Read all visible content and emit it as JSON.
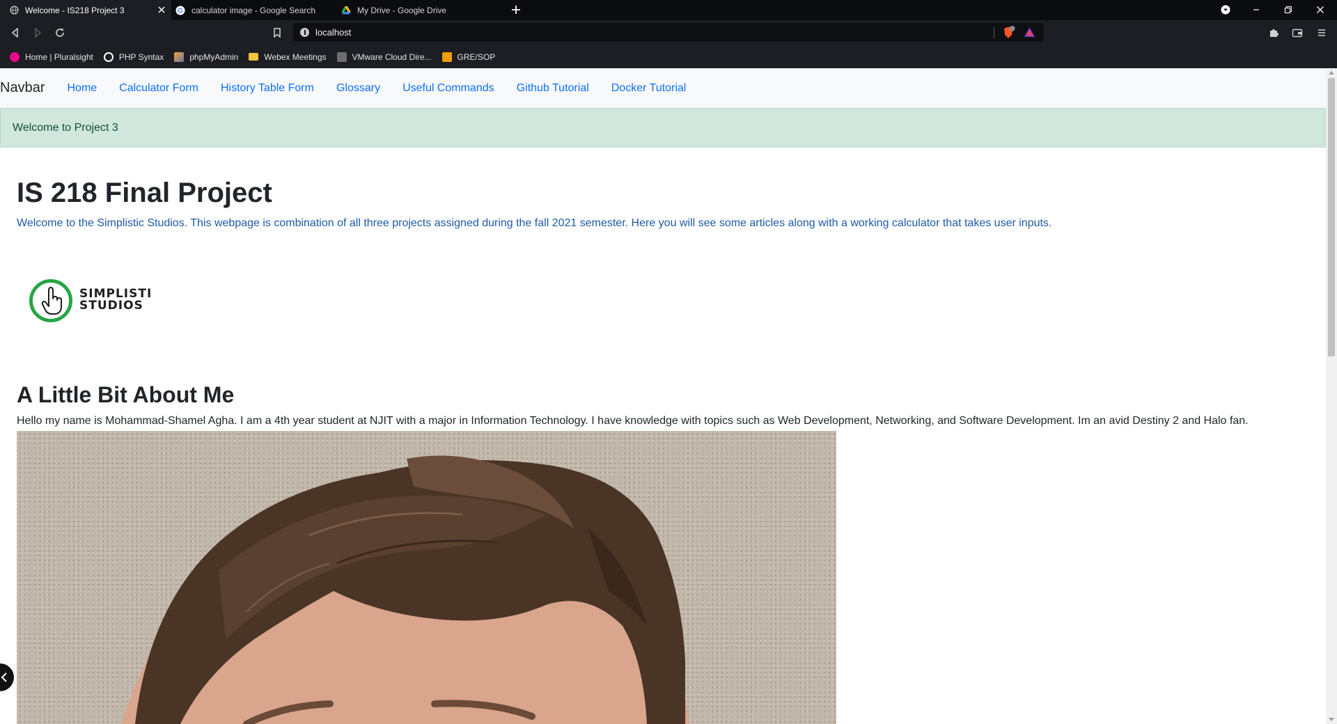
{
  "browser": {
    "tabs": [
      {
        "title": "Welcome - IS218 Project 3",
        "active": true
      },
      {
        "title": "calculator image - Google Search",
        "active": false
      },
      {
        "title": "My Drive - Google Drive",
        "active": false
      }
    ],
    "url": "localhost",
    "bookmarks": [
      {
        "label": "Home | Pluralsight",
        "icon": "pluralsight-icon",
        "color": "#e80a89"
      },
      {
        "label": "PHP Syntax",
        "icon": "circle-icon",
        "color": "#ffffff"
      },
      {
        "label": "phpMyAdmin",
        "icon": "phpmyadmin-icon",
        "color": "#f0a030"
      },
      {
        "label": "Webex Meetings",
        "icon": "folder-icon",
        "color": "#f4c542"
      },
      {
        "label": "VMware Cloud Dire...",
        "icon": "vmware-icon",
        "color": "#6d6d6d"
      },
      {
        "label": "GRE/SOP",
        "icon": "bookmark-icon",
        "color": "#f59b00"
      }
    ]
  },
  "page": {
    "navbar": {
      "brand": "Navbar",
      "links": [
        "Home",
        "Calculator Form",
        "History Table Form",
        "Glossary",
        "Useful Commands",
        "Github Tutorial",
        "Docker Tutorial"
      ],
      "link_color": "#0d6efd"
    },
    "alert": {
      "text": "Welcome to Project 3",
      "bg": "#d1e7dd"
    },
    "title": "IS 218 Final Project",
    "lead": "Welcome to the Simplistic Studios. This webpage is combination of all three projects assigned during the fall 2021 semester. Here you will see some articles along with a working calculator that takes user inputs.",
    "logo": {
      "line1": "SIMPLISTI",
      "line2": "STUDIOS",
      "ring_color": "#27a544"
    },
    "about": {
      "heading": "A Little Bit About Me",
      "text": "Hello my name is Mohammad-Shamel Agha. I am a 4th year student at NJIT with a major in Information Technology. I have knowledge with topics such as Web Development, Networking, and Software Development. Im an avid Destiny 2 and Halo fan."
    }
  }
}
